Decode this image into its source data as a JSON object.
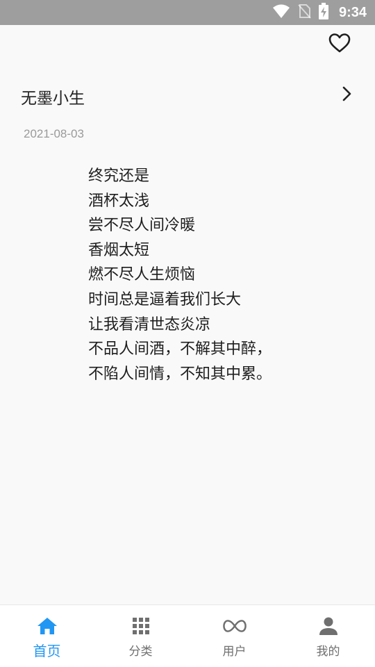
{
  "status_bar": {
    "time": "9:34",
    "icons": [
      "wifi-icon",
      "no-sim-icon",
      "battery-charging-icon"
    ]
  },
  "post": {
    "favorite_icon": "heart-outline-icon",
    "author": "无墨小生",
    "date": "2021-08-03",
    "lines": [
      "终究还是",
      "酒杯太浅",
      "尝不尽人间冷暖",
      "香烟太短",
      "燃不尽人生烦恼",
      "时间总是逼着我们长大",
      "让我看清世态炎凉",
      "不品人间酒，不解其中醉，",
      "不陷人间情，不知其中累。"
    ]
  },
  "bottom_nav": {
    "active_color": "#2196f3",
    "inactive_color": "#6f6f6f",
    "items": [
      {
        "label": "首页",
        "icon": "home-icon",
        "active": true
      },
      {
        "label": "分类",
        "icon": "grid-icon",
        "active": false
      },
      {
        "label": "用户",
        "icon": "infinity-icon",
        "active": false
      },
      {
        "label": "我的",
        "icon": "person-icon",
        "active": false
      }
    ]
  }
}
